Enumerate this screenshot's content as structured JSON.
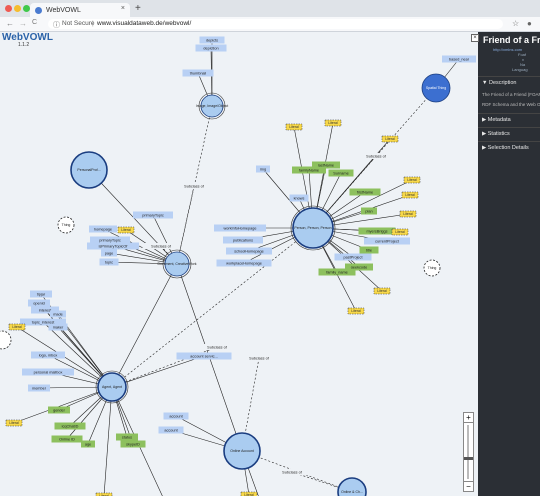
{
  "browser": {
    "tab_title": "WebVOWL",
    "tab_close": "×",
    "new_tab": "+",
    "security": "Not Secure",
    "url": "www.visualdataweb.de/webvowl/",
    "nav_back": "←",
    "nav_forward": "→",
    "nav_reload": "C",
    "icons": [
      "star-icon",
      "account-icon"
    ]
  },
  "app": {
    "name": "WebVOWL",
    "version": "1.1.2"
  },
  "sidebar": {
    "title": "Friend of a Frien",
    "meta": [
      "Foaf",
      "v",
      "Na",
      "Languag"
    ],
    "sections": [
      {
        "label": "▼ Description",
        "content": [
          "The Friend of a Friend (FOAF)",
          "RDF Schema and the Web Ontol"
        ]
      },
      {
        "label": "▶ Metadata"
      },
      {
        "label": "▶ Statistics"
      },
      {
        "label": "▶ Selection Details"
      }
    ]
  },
  "graph": {
    "nodes": [
      {
        "id": "image",
        "label": "Image, Image/Object",
        "kind": "class"
      },
      {
        "id": "spatial",
        "label": "Spatial Thing",
        "kind": "external"
      },
      {
        "id": "personal",
        "label": "PersonalProf...",
        "kind": "class"
      },
      {
        "id": "document",
        "label": "Document, CreativeWork",
        "kind": "class"
      },
      {
        "id": "person",
        "label": "Person, Person, Person",
        "kind": "class"
      },
      {
        "id": "agent",
        "label": "Agent, Agent",
        "kind": "class"
      },
      {
        "id": "online",
        "label": "Online Account",
        "kind": "class"
      },
      {
        "id": "thing1",
        "label": "Thing",
        "kind": "thing"
      },
      {
        "id": "thing2",
        "label": "Thing",
        "kind": "thing"
      },
      {
        "id": "thing3",
        "label": "",
        "kind": "thing"
      },
      {
        "id": "chat",
        "label": "Online & Ch...",
        "kind": "class"
      }
    ],
    "props": [
      {
        "label": "depicts",
        "kind": "obj"
      },
      {
        "label": "depiction",
        "kind": "obj"
      },
      {
        "label": "thumbnail",
        "kind": "obj"
      },
      {
        "label": "based_near",
        "kind": "obj"
      },
      {
        "label": "img",
        "kind": "obj"
      },
      {
        "label": "Subclass of",
        "kind": "plain"
      },
      {
        "label": "Subclass of",
        "kind": "plain"
      },
      {
        "label": "Subclass of",
        "kind": "plain"
      },
      {
        "label": "Subclass of",
        "kind": "plain"
      },
      {
        "label": "primaryTopic",
        "kind": "obj"
      },
      {
        "label": "Subclass of",
        "kind": "plain"
      },
      {
        "label": "knows",
        "kind": "obj"
      },
      {
        "label": "familyName",
        "kind": "data"
      },
      {
        "label": "lastName",
        "kind": "data"
      },
      {
        "label": "Surname",
        "kind": "data"
      },
      {
        "label": "firstName",
        "kind": "data"
      },
      {
        "label": "plan",
        "kind": "data"
      },
      {
        "label": "myersBriggs",
        "kind": "data"
      },
      {
        "label": "title",
        "kind": "data"
      },
      {
        "label": "currentProject",
        "kind": "obj"
      },
      {
        "label": "workInfoHomepage",
        "kind": "obj"
      },
      {
        "label": "publications",
        "kind": "obj"
      },
      {
        "label": "schoolHomepage",
        "kind": "obj"
      },
      {
        "label": "workplaceHomepage",
        "kind": "obj"
      },
      {
        "label": "pastProject",
        "kind": "obj"
      },
      {
        "label": "geekcode",
        "kind": "data"
      },
      {
        "label": "family_name",
        "kind": "data"
      },
      {
        "label": "homepage",
        "kind": "obj"
      },
      {
        "label": "primaryTopic",
        "kind": "obj"
      },
      {
        "label": "isPrimaryTopicOf",
        "kind": "obj"
      },
      {
        "label": "page",
        "kind": "obj"
      },
      {
        "label": "topic",
        "kind": "obj"
      },
      {
        "label": "tipjar",
        "kind": "obj"
      },
      {
        "label": "openid",
        "kind": "obj"
      },
      {
        "label": "interest",
        "kind": "obj"
      },
      {
        "label": "topic_interest",
        "kind": "obj"
      },
      {
        "label": "made",
        "kind": "obj"
      },
      {
        "label": "maker",
        "kind": "obj"
      },
      {
        "label": "logo, mbox",
        "kind": "obj"
      },
      {
        "label": "personal mailbox",
        "kind": "obj"
      },
      {
        "label": "member",
        "kind": "obj"
      },
      {
        "label": "gender",
        "kind": "data"
      },
      {
        "label": "icqChatID",
        "kind": "data"
      },
      {
        "label": "Online ID",
        "kind": "data"
      },
      {
        "label": "age",
        "kind": "data"
      },
      {
        "label": "status",
        "kind": "data"
      },
      {
        "label": "skypeID",
        "kind": "data"
      },
      {
        "label": "account",
        "kind": "obj"
      },
      {
        "label": "account",
        "kind": "obj"
      },
      {
        "label": "account servic...",
        "kind": "obj"
      },
      {
        "label": "Subclass of",
        "kind": "plain"
      }
    ],
    "literals": [
      "Literal"
    ]
  },
  "zoom": {
    "plus": "+",
    "minus": "−"
  },
  "colors": {
    "class": "#aaccf0",
    "external": "#3c6fd0",
    "obj": "#b8d0f4",
    "data": "#8dc05e",
    "literal": "#f7d84a",
    "bg": "#eef2f6"
  }
}
